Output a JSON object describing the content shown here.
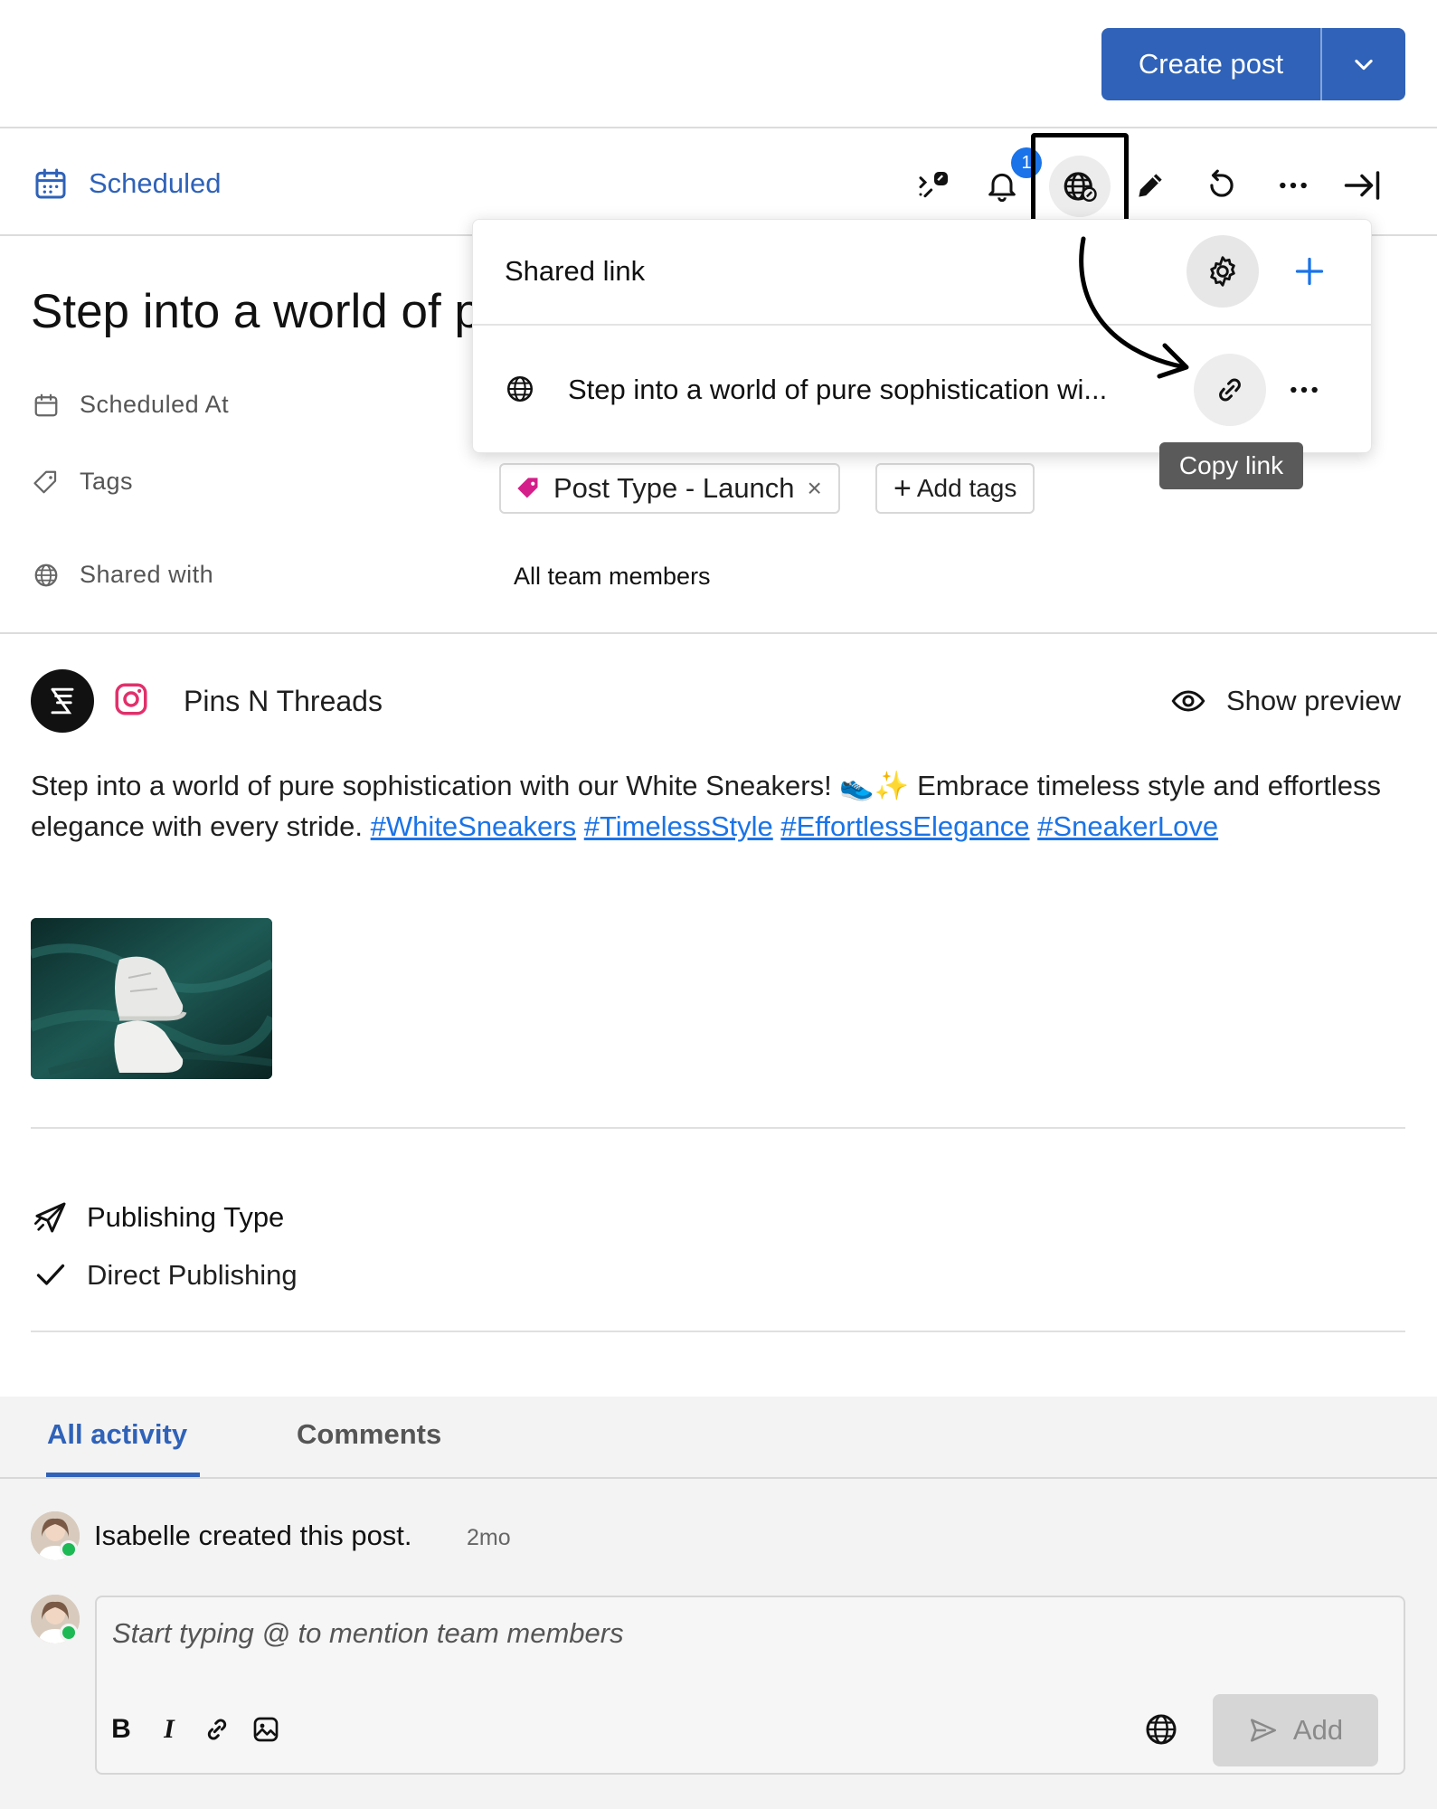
{
  "header": {
    "create_post_label": "Create post"
  },
  "status_bar": {
    "status_label": "Scheduled",
    "notification_count": "1"
  },
  "post": {
    "title": "Step into a world of p",
    "meta": {
      "scheduled_at_label": "Scheduled At",
      "tags_label": "Tags",
      "shared_with_label": "Shared with",
      "tag_chip": "Post Type - Launch",
      "tag_remove": "×",
      "add_tags_label": "Add tags",
      "shared_with_value": "All team members"
    },
    "account_name": "Pins N Threads",
    "show_preview_label": "Show preview",
    "body_text": "Step into a world of pure sophistication with our White Sneakers! 👟✨ Embrace timeless style and effortless elegance with every stride.",
    "hashtags": [
      "#WhiteSneakers",
      "#TimelessStyle",
      "#EffortlessElegance",
      "#SneakerLove"
    ]
  },
  "publishing": {
    "title": "Publishing Type",
    "value": "Direct Publishing"
  },
  "activity": {
    "tabs": [
      {
        "label": "All activity",
        "active": true
      },
      {
        "label": "Comments",
        "active": false
      }
    ],
    "entries": [
      {
        "user": "Isabelle",
        "action": "created this post.",
        "text": "Isabelle created this post.",
        "time": "2mo"
      }
    ],
    "comment_placeholder": "Start typing @ to mention team members",
    "format_bold": "B",
    "format_italic": "I",
    "add_button_label": "Add"
  },
  "shared_link_popover": {
    "heading": "Shared link",
    "link_title": "Step into a world of pure sophistication wi...",
    "copy_tooltip": "Copy link"
  },
  "colors": {
    "brand_blue": "#2f62b8",
    "link_blue": "#1a73e8",
    "online_green": "#1db954",
    "tag_pink": "#d41f8a"
  }
}
